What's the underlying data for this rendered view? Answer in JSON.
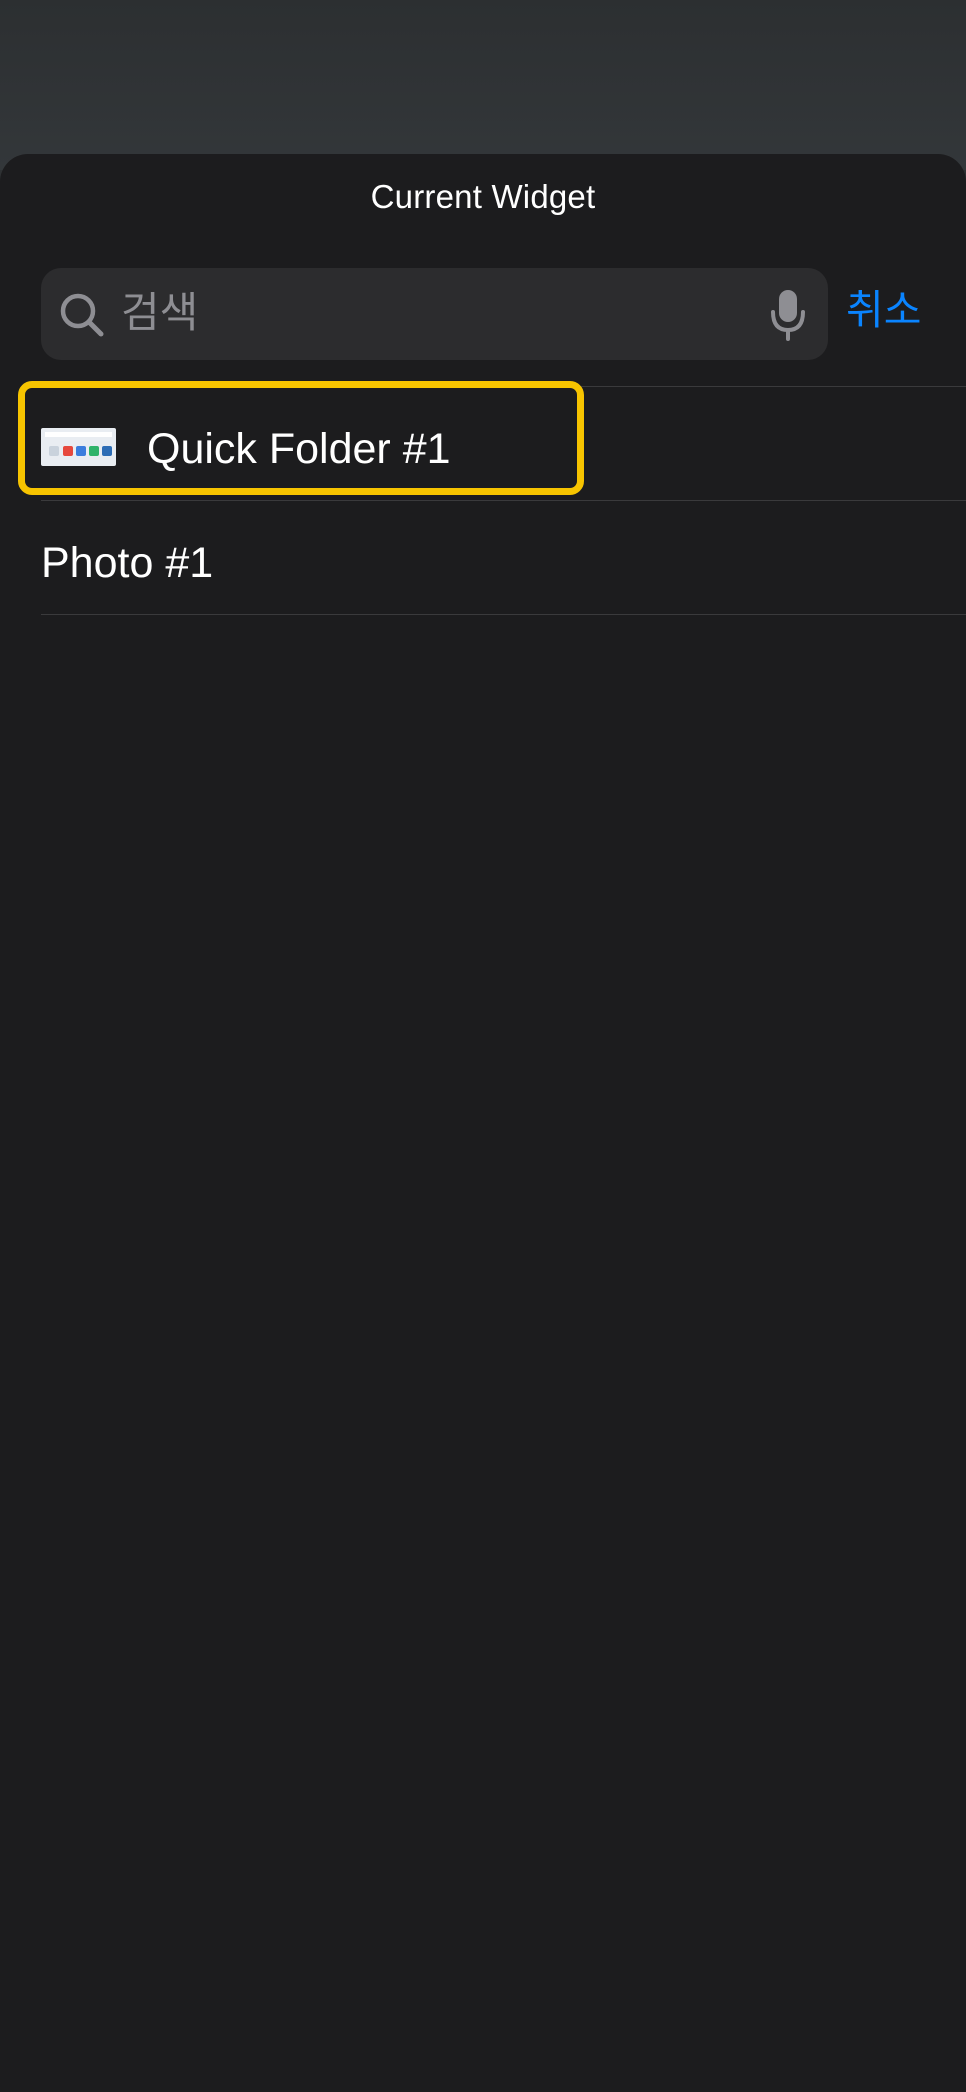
{
  "sheet": {
    "title": "Current Widget"
  },
  "search": {
    "placeholder": "검색",
    "search_icon": "magnifying-glass-icon",
    "mic_icon": "microphone-icon",
    "cancel_label": "취소"
  },
  "list": {
    "items": [
      {
        "label": "Quick Folder #1",
        "has_thumbnail": true,
        "highlighted": true
      },
      {
        "label": "Photo #1",
        "has_thumbnail": false,
        "highlighted": false
      }
    ]
  },
  "colors": {
    "sheet_background": "#1c1c1e",
    "search_field": "#2c2c2e",
    "accent_blue": "#0a84ff",
    "highlight_yellow": "#f7c400",
    "placeholder_gray": "#8e8e93"
  }
}
